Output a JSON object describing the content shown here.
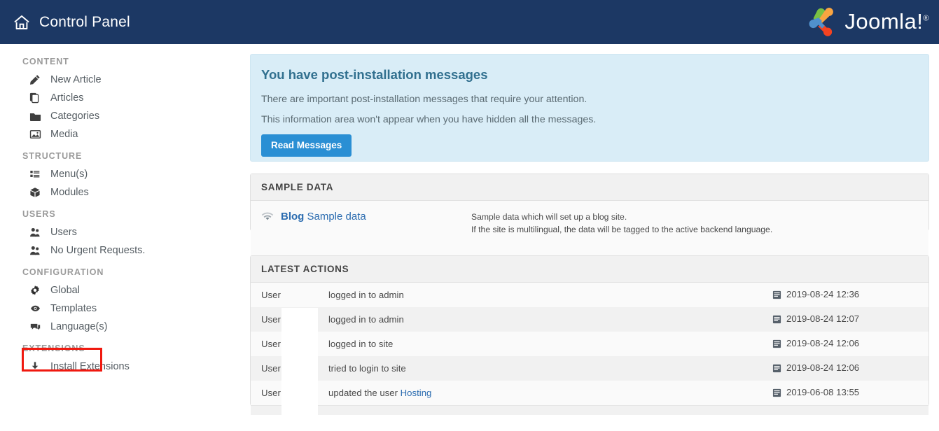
{
  "header": {
    "title": "Control Panel",
    "home_icon": "home-icon",
    "brand": "Joomla!",
    "brand_registered": "®",
    "bg_color": "#1c3864"
  },
  "sidebar": {
    "groups": [
      {
        "title": "CONTENT",
        "items": [
          {
            "label": "New Article",
            "icon": "pencil-icon"
          },
          {
            "label": "Articles",
            "icon": "copy-icon"
          },
          {
            "label": "Categories",
            "icon": "folder-icon"
          },
          {
            "label": "Media",
            "icon": "image-icon"
          }
        ]
      },
      {
        "title": "STRUCTURE",
        "items": [
          {
            "label": "Menu(s)",
            "icon": "list-icon"
          },
          {
            "label": "Modules",
            "icon": "cube-icon"
          }
        ]
      },
      {
        "title": "USERS",
        "items": [
          {
            "label": "Users",
            "icon": "users-icon"
          },
          {
            "label": "No Urgent Requests.",
            "icon": "users-icon"
          }
        ]
      },
      {
        "title": "CONFIGURATION",
        "items": [
          {
            "label": "Global",
            "icon": "gear-icon",
            "highlighted": true
          },
          {
            "label": "Templates",
            "icon": "eye-icon"
          },
          {
            "label": "Language(s)",
            "icon": "comment-icon"
          }
        ]
      },
      {
        "title": "EXTENSIONS",
        "items": [
          {
            "label": "Install Extensions",
            "icon": "download-icon"
          }
        ]
      }
    ],
    "highlight_color": "#f0190f"
  },
  "main": {
    "info_panel": {
      "title": "You have post-installation messages",
      "line1": "There are important post-installation messages that require your attention.",
      "line2": "This information area won't appear when you have hidden all the messages.",
      "button_label": "Read Messages",
      "bg_color": "#d9edf7",
      "title_color": "#31708f",
      "button_color": "#2a8fd4"
    },
    "sample_data": {
      "heading": "SAMPLE DATA",
      "icon": "wifi-icon",
      "link_bold": "Blog",
      "link_rest": "Sample data",
      "desc_line1": "Sample data which will set up a blog site.",
      "desc_line2": "If the site is multilingual, the data will be tagged to the active backend language."
    },
    "latest_actions": {
      "heading": "LATEST ACTIONS",
      "date_icon": "calendar-list-icon",
      "rows": [
        {
          "user": "User",
          "action": "logged in to admin",
          "link": "",
          "date": "2019-08-24 12:36"
        },
        {
          "user": "User",
          "action": "logged in to admin",
          "link": "",
          "date": "2019-08-24 12:07"
        },
        {
          "user": "User",
          "action": "logged in to site",
          "link": "",
          "date": "2019-08-24 12:06"
        },
        {
          "user": "User",
          "action": "tried to login to site",
          "link": "",
          "date": "2019-08-24 12:06"
        },
        {
          "user": "User",
          "action": "updated the user ",
          "link": "Hosting",
          "date": "2019-06-08 13:55"
        }
      ]
    }
  }
}
